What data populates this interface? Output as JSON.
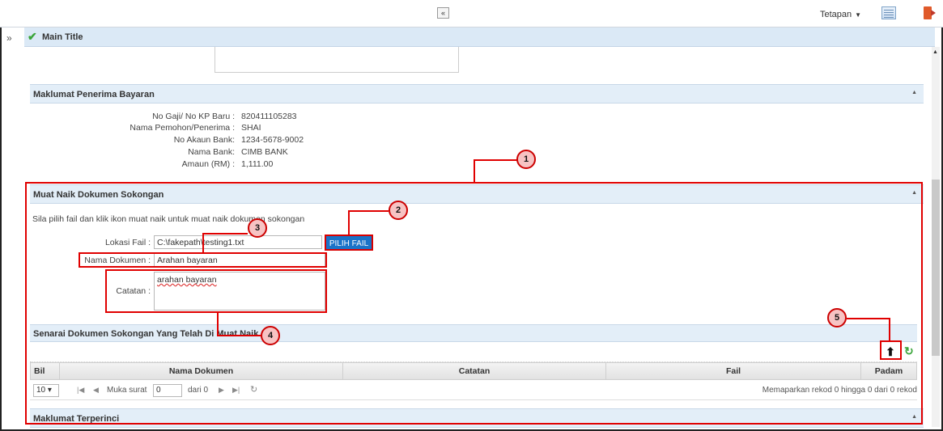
{
  "header": {
    "settings_label": "Tetapan",
    "collapse_glyph": "«",
    "main_title": "Main Title",
    "side_toggle_glyph": "»"
  },
  "penerima": {
    "title": "Maklumat Penerima Bayaran",
    "rows": [
      {
        "label": "No Gaji/ No KP Baru :",
        "value": "820411105283"
      },
      {
        "label": "Nama Pemohon/Penerima :",
        "value": "SHAI"
      },
      {
        "label": "No Akaun Bank:",
        "value": "1234-5678-9002"
      },
      {
        "label": "Nama Bank:",
        "value": "CIMB BANK"
      },
      {
        "label": "Amaun (RM) :",
        "value": "1,111.00"
      }
    ]
  },
  "muat_naik": {
    "title": "Muat Naik Dokumen Sokongan",
    "instruction": "Sila pilih fail dan klik ikon muat naik untuk muat naik dokumen sokongan",
    "lokasi_label": "Lokasi Fail :",
    "lokasi_value": "C:\\fakepath\\testing1.txt",
    "pilih_button": "PILIH FAIL",
    "nama_label": "Nama Dokumen :",
    "nama_value": "Arahan bayaran",
    "catatan_label": "Catatan :",
    "catatan_value": "arahan bayaran"
  },
  "senarai": {
    "title": "Senarai Dokumen Sokongan Yang Telah Di Muat Naik",
    "columns": [
      "Bil",
      "Nama Dokumen",
      "Catatan",
      "Fail",
      "Padam"
    ],
    "page_size": "10 ▾",
    "page_label": "Muka surat",
    "page_value": "0",
    "of_label": "dari 0",
    "record_info": "Memaparkan rekod 0 hingga 0 dari 0 rekod"
  },
  "terperinci": {
    "title": "Maklumat Terperinci"
  },
  "callouts": [
    "1",
    "2",
    "3",
    "4",
    "5"
  ],
  "colors": {
    "annotation_red": "#e00000",
    "button_blue": "#1a73c8",
    "section_header": "#e3eef8"
  }
}
